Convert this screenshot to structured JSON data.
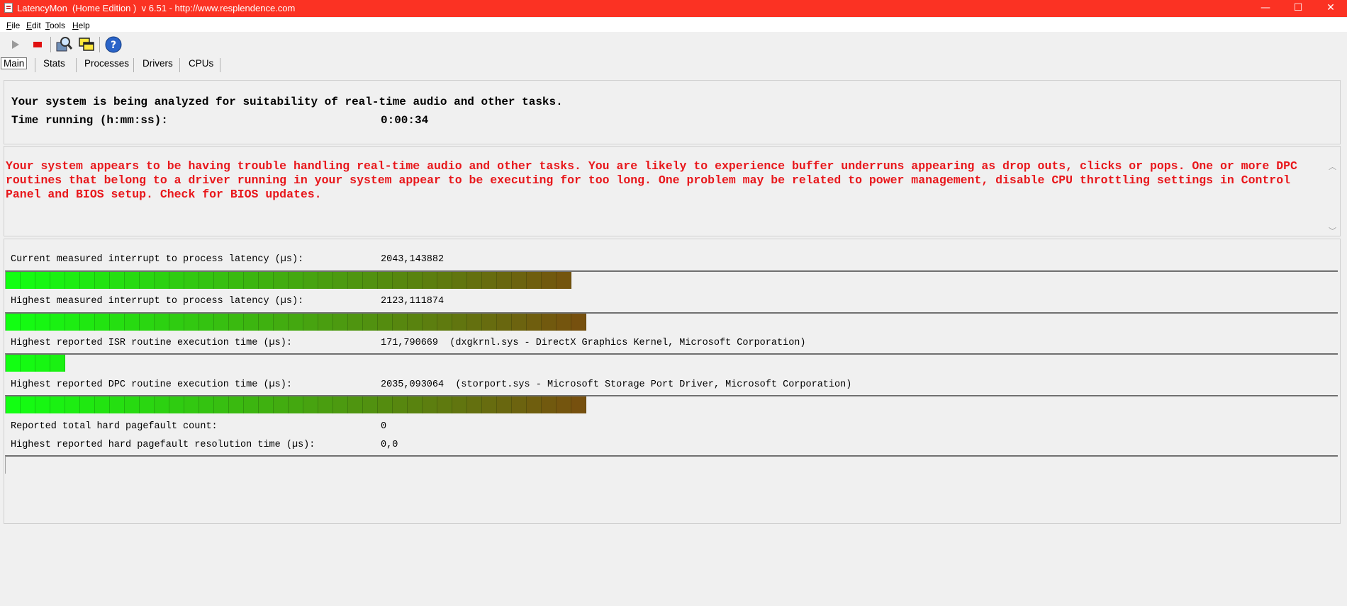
{
  "window": {
    "title": "LatencyMon  (Home Edition )  v 6.51 - http://www.resplendence.com",
    "controls": [
      "—",
      "☐",
      "✕"
    ]
  },
  "menu": [
    {
      "label": "File",
      "key": "F",
      "rest": "ile"
    },
    {
      "label": "Edit",
      "key": "E",
      "rest": "dit"
    },
    {
      "label": "Tools",
      "key": "T",
      "rest": "ools"
    },
    {
      "label": "Help",
      "key": "H",
      "rest": "elp"
    }
  ],
  "toolbar": {
    "start_icon": "play-icon",
    "stop_icon": "stop-icon",
    "analyze_icon": "magnifier-icon",
    "windows_icon": "windows-icon",
    "help_icon": "help-icon"
  },
  "tabs": {
    "main": "Main",
    "stats": "Stats",
    "processes": "Processes",
    "drivers": "Drivers",
    "cpus": "CPUs"
  },
  "status": {
    "line1": "Your system is being analyzed for suitability of real-time audio and other tasks.",
    "time_label": "Time running (h:mm:ss):",
    "time_value": "0:00:34"
  },
  "warning": "Your system appears to be having trouble handling real-time audio and other tasks. You are likely to experience buffer underruns appearing as drop outs, clicks or pops. One or more DPC routines that belong to a driver running in your system appear to be executing for too long. One problem may be related to power management, disable CPU throttling settings in Control Panel and BIOS setup. Check for BIOS updates.",
  "metrics": {
    "current_latency": {
      "label": "Current measured interrupt to process latency (µs):",
      "value": "2043,143882",
      "bar_fraction": 0.43
    },
    "highest_latency": {
      "label": "Highest measured interrupt to process latency (µs):",
      "value": "2123,111874",
      "bar_fraction": 0.44
    },
    "isr": {
      "label": "Highest reported ISR routine execution time (µs):",
      "value": "171,790669  (dxgkrnl.sys - DirectX Graphics Kernel, Microsoft Corporation)",
      "bar_fraction": 0.045
    },
    "dpc": {
      "label": "Highest reported DPC routine execution time (µs):",
      "value": "2035,093064  (storport.sys - Microsoft Storage Port Driver, Microsoft Corporation)",
      "bar_fraction": 0.44
    },
    "pagefault_count": {
      "label": "Reported total hard pagefault count:",
      "value": "0"
    },
    "pagefault_time": {
      "label": "Highest reported hard pagefault resolution time (µs):",
      "value": "0,0",
      "bar_fraction": 0
    }
  },
  "colors": {
    "titlebar": "#fb3223",
    "warning_text": "#e8171b",
    "bar_start": "#12ff12",
    "bar_end": "#7a4a0e"
  }
}
